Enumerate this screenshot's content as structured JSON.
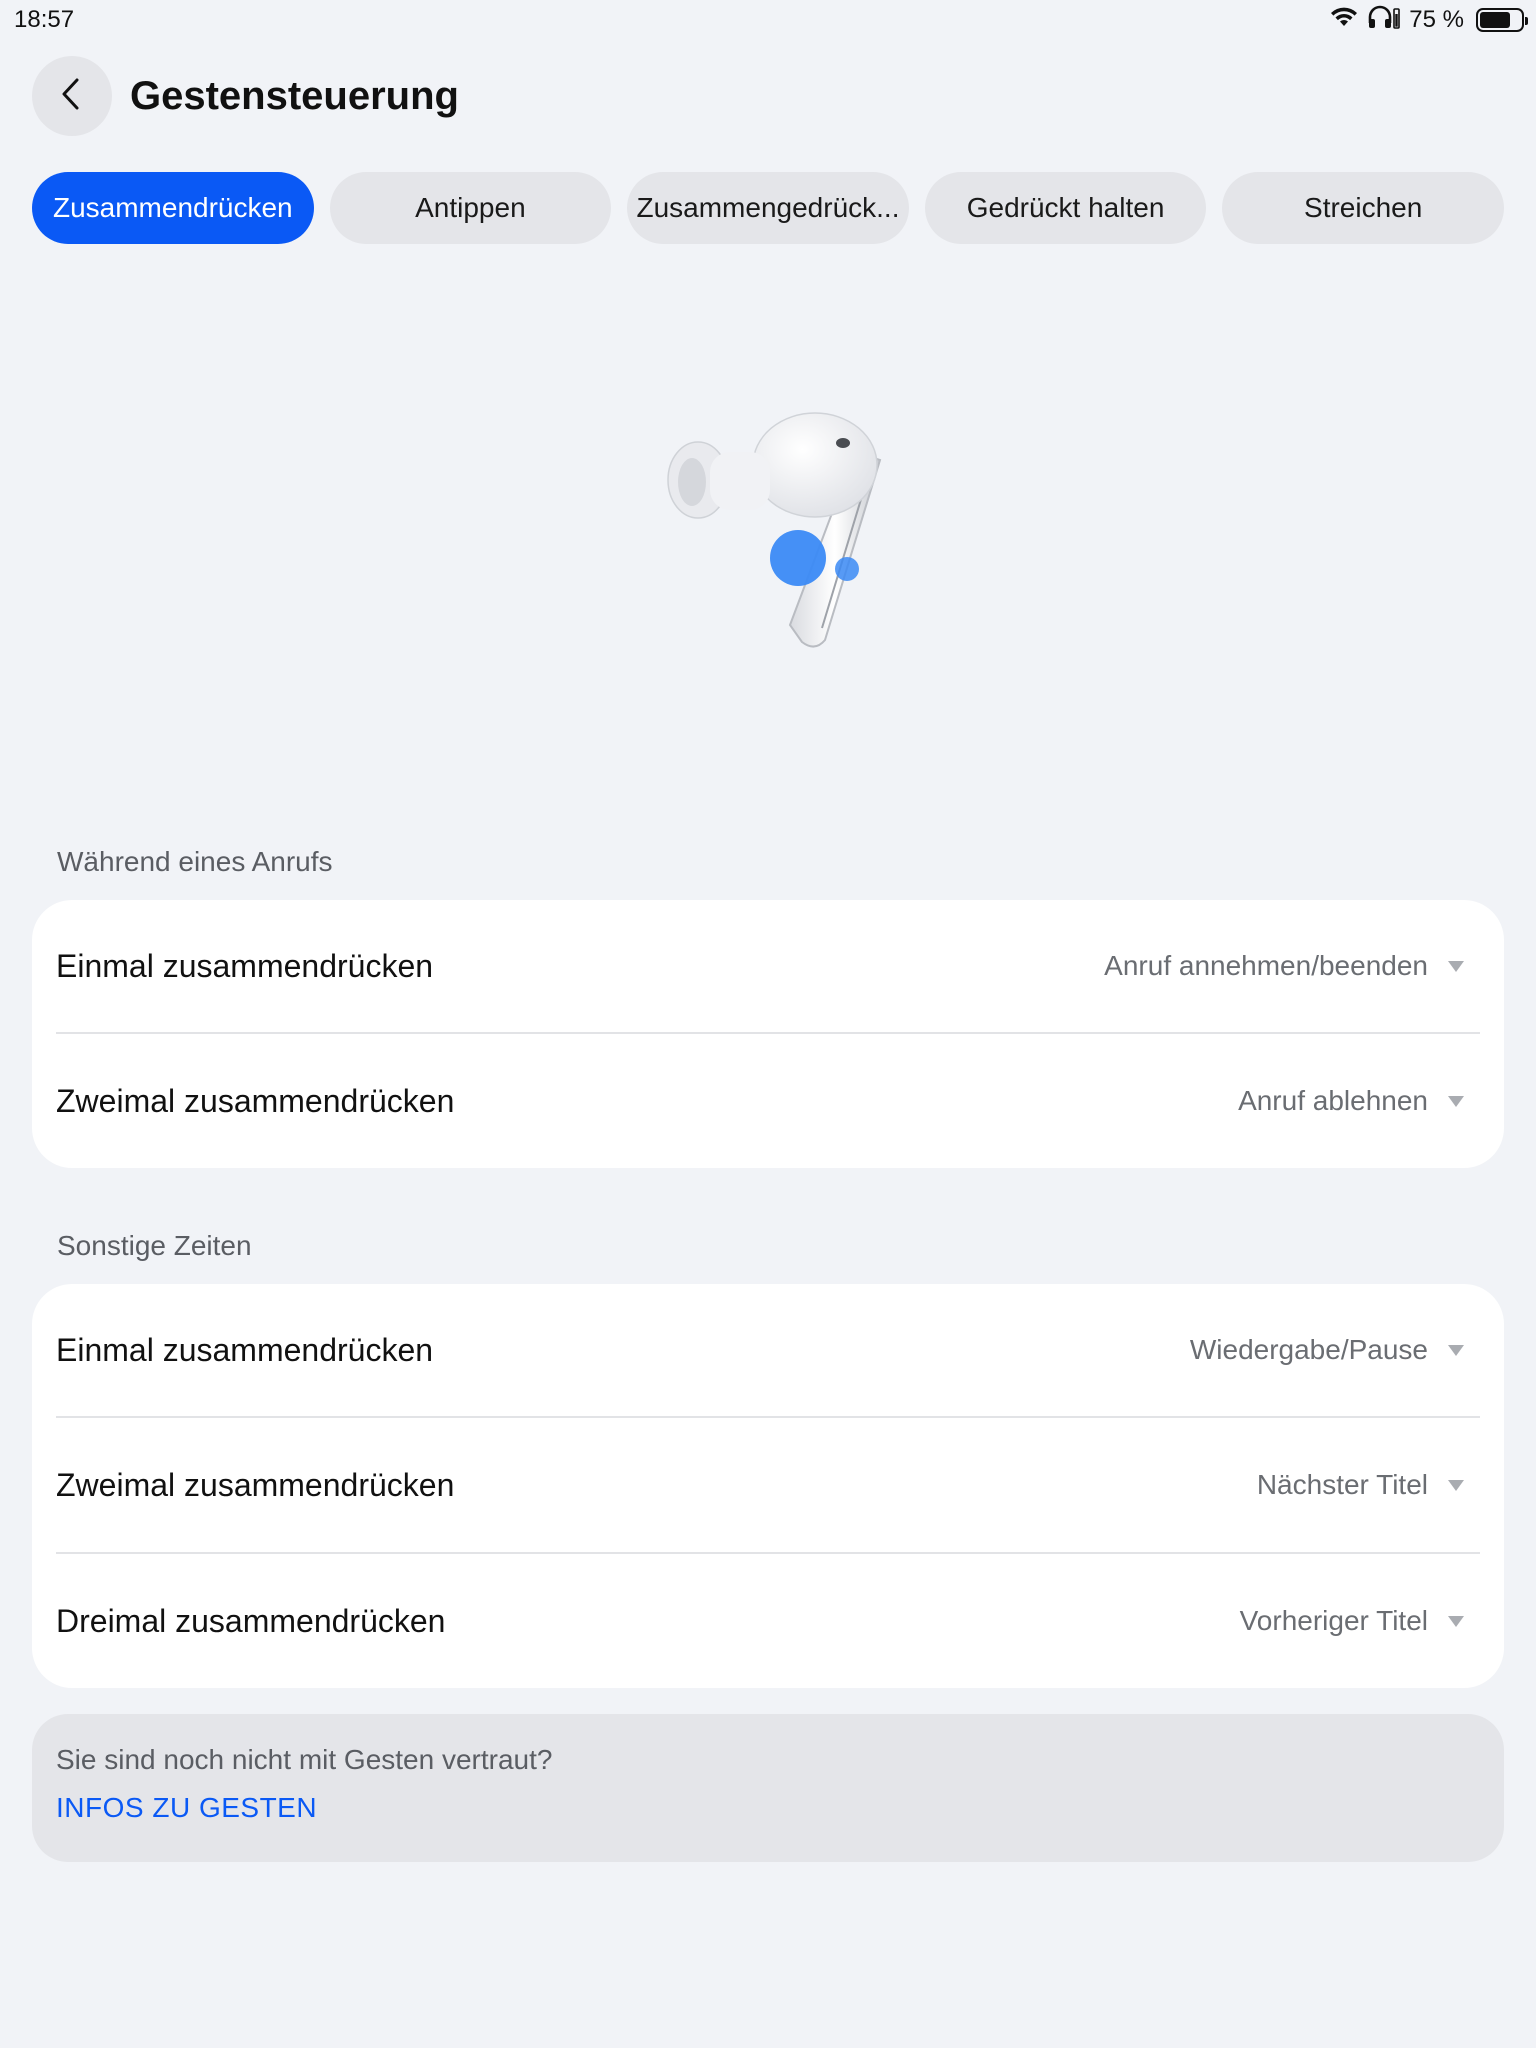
{
  "status": {
    "time": "18:57",
    "battery_text": "75 %",
    "battery_level": 0.75
  },
  "header": {
    "title": "Gestensteuerung"
  },
  "tabs": [
    {
      "label": "Zusammendrücken",
      "active": true
    },
    {
      "label": "Antippen",
      "active": false
    },
    {
      "label": "Zusammengedrück...",
      "active": false
    },
    {
      "label": "Gedrückt halten",
      "active": false
    },
    {
      "label": "Streichen",
      "active": false
    }
  ],
  "sections": [
    {
      "label": "Während eines Anrufs",
      "rows": [
        {
          "title": "Einmal zusammendrücken",
          "value": "Anruf annehmen/beenden"
        },
        {
          "title": "Zweimal zusammendrücken",
          "value": "Anruf ablehnen"
        }
      ]
    },
    {
      "label": "Sonstige Zeiten",
      "rows": [
        {
          "title": "Einmal zusammendrücken",
          "value": "Wiedergabe/Pause"
        },
        {
          "title": "Zweimal zusammendrücken",
          "value": "Nächster Titel"
        },
        {
          "title": "Dreimal zusammendrücken",
          "value": "Vorheriger Titel"
        }
      ]
    }
  ],
  "info": {
    "text": "Sie sind noch nicht mit Gesten vertraut?",
    "link": "INFOS ZU GESTEN"
  },
  "colors": {
    "accent": "#0a59f5",
    "background": "#f1f3f7",
    "touch_indicator": "#3b8af5"
  },
  "icons": {
    "back": "chevron-left-icon",
    "wifi": "wifi-icon",
    "headphones": "headphones-icon",
    "battery": "battery-icon",
    "dropdown": "caret-down-icon"
  }
}
